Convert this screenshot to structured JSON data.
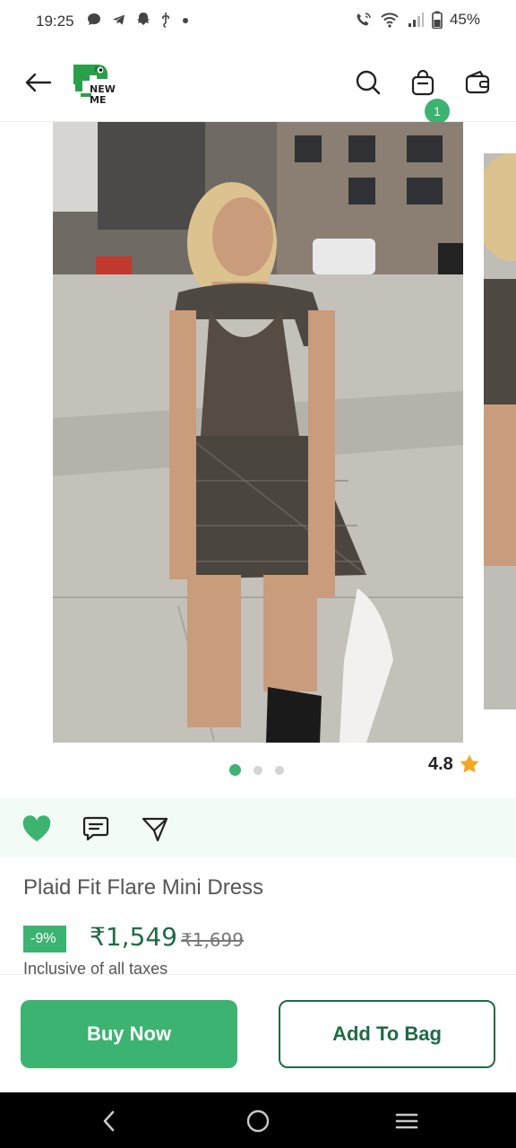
{
  "status_bar": {
    "time": "19:25",
    "battery": "45%",
    "left_icons": [
      "chat-bubble-icon",
      "telegram-icon",
      "snapchat-icon",
      "usb-icon",
      "dot-icon"
    ],
    "right_icons": [
      "wifi-call-icon",
      "wifi-icon",
      "signal-icon",
      "battery-icon"
    ]
  },
  "header": {
    "logo_text_line1": "NEW",
    "logo_text_line2": "ME",
    "bag_count": "1",
    "icons": [
      "back-arrow-icon",
      "search-icon",
      "bag-icon",
      "wallet-icon"
    ]
  },
  "carousel": {
    "dots": 3,
    "active_index": 0,
    "rating": "4.8"
  },
  "actions": {
    "icons": [
      "heart-icon",
      "chat-icon",
      "share-icon"
    ]
  },
  "product": {
    "title": "Plaid Fit Flare Mini Dress",
    "discount": "-9%",
    "price": "₹1,549",
    "mrp": "₹1,699",
    "tax_note": "Inclusive of all taxes"
  },
  "buttons": {
    "buy_now": "Buy Now",
    "add_to_bag": "Add To Bag"
  },
  "colors": {
    "accent": "#3cb371",
    "dark_green": "#1f6b45",
    "action_row_bg": "#f3fbf7",
    "rating_star": "#f5a623"
  }
}
